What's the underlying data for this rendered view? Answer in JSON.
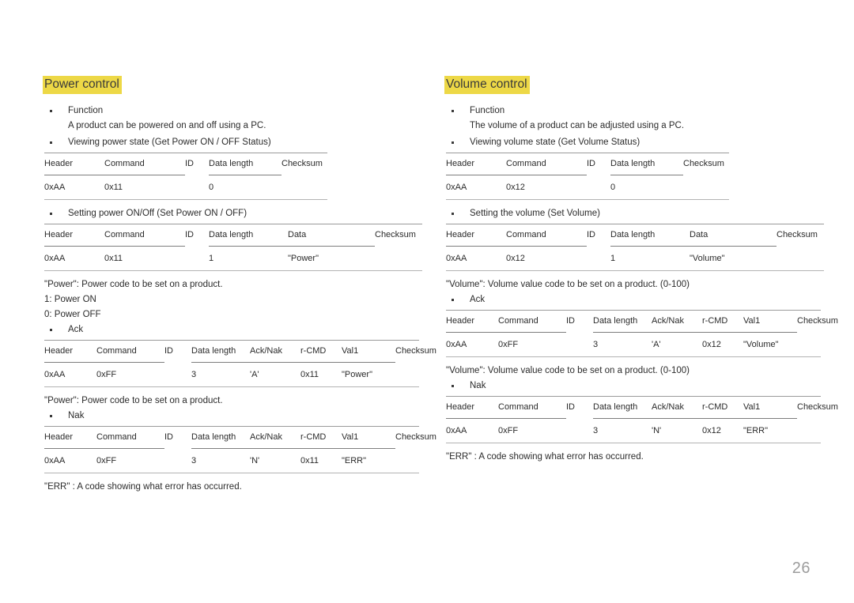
{
  "page": {
    "number": "26",
    "highlight_color": "#edd846",
    "text_color": "#2b2b2b",
    "rule_color": "#9a9a9a"
  },
  "left_column": {
    "heading": "Power control",
    "blocks": [
      {
        "bullet": "Function",
        "sub": "A product can be powered on and off using a PC."
      },
      {
        "bullet": "Viewing power state (Get Power ON / OFF Status)"
      }
    ],
    "table_get": {
      "headers": [
        "Header",
        "Command",
        "ID",
        "Data length",
        "Checksum"
      ],
      "values": [
        "0xAA",
        "0x11",
        "",
        "0",
        ""
      ]
    },
    "bullet_set": "Setting power ON/Off (Set Power ON / OFF)",
    "table_set": {
      "headers": [
        "Header",
        "Command",
        "ID",
        "Data length",
        "Data",
        "Checksum"
      ],
      "values": [
        "0xAA",
        "0x11",
        "",
        "1",
        "\"Power\"",
        ""
      ]
    },
    "notes_after_set": [
      "\"Power\": Power code to be set on a product.",
      "1: Power ON",
      "0: Power OFF"
    ],
    "bullet_ack": "Ack",
    "table_ack": {
      "headers": [
        "Header",
        "Command",
        "ID",
        "Data length",
        "Ack/Nak",
        "r-CMD",
        "Val1",
        "Checksum"
      ],
      "values": [
        "0xAA",
        "0xFF",
        "",
        "3",
        "'A'",
        "0x11",
        "\"Power\"",
        ""
      ]
    },
    "note_after_ack": "\"Power\": Power code to be set on a product.",
    "bullet_nak": "Nak",
    "table_nak": {
      "headers": [
        "Header",
        "Command",
        "ID",
        "Data length",
        "Ack/Nak",
        "r-CMD",
        "Val1",
        "Checksum"
      ],
      "values": [
        "0xAA",
        "0xFF",
        "",
        "3",
        "'N'",
        "0x11",
        "\"ERR\"",
        ""
      ]
    },
    "note_after_nak": "\"ERR\" : A code showing what error has occurred."
  },
  "right_column": {
    "heading": "Volume control",
    "blocks": [
      {
        "bullet": "Function",
        "sub": "The volume of a product can be adjusted using a PC."
      },
      {
        "bullet": "Viewing volume state (Get Volume Status)"
      }
    ],
    "table_get": {
      "headers": [
        "Header",
        "Command",
        "ID",
        "Data length",
        "Checksum"
      ],
      "values": [
        "0xAA",
        "0x12",
        "",
        "0",
        ""
      ]
    },
    "bullet_set": "Setting the volume (Set Volume)",
    "table_set": {
      "headers": [
        "Header",
        "Command",
        "ID",
        "Data length",
        "Data",
        "Checksum"
      ],
      "values": [
        "0xAA",
        "0x12",
        "",
        "1",
        "\"Volume\"",
        ""
      ]
    },
    "note_after_set": "\"Volume\": Volume value code to be set on a product. (0-100)",
    "bullet_ack": "Ack",
    "table_ack": {
      "headers": [
        "Header",
        "Command",
        "ID",
        "Data length",
        "Ack/Nak",
        "r-CMD",
        "Val1",
        "Checksum"
      ],
      "values": [
        "0xAA",
        "0xFF",
        "",
        "3",
        "'A'",
        "0x12",
        "\"Volume\"",
        ""
      ]
    },
    "note_after_ack": "\"Volume\": Volume value code to be set on a product. (0-100)",
    "bullet_nak": "Nak",
    "table_nak": {
      "headers": [
        "Header",
        "Command",
        "ID",
        "Data length",
        "Ack/Nak",
        "r-CMD",
        "Val1",
        "Checksum"
      ],
      "values": [
        "0xAA",
        "0xFF",
        "",
        "3",
        "'N'",
        "0x12",
        "\"ERR\"",
        ""
      ]
    },
    "note_after_nak": "\"ERR\" : A code showing what error has occurred."
  }
}
